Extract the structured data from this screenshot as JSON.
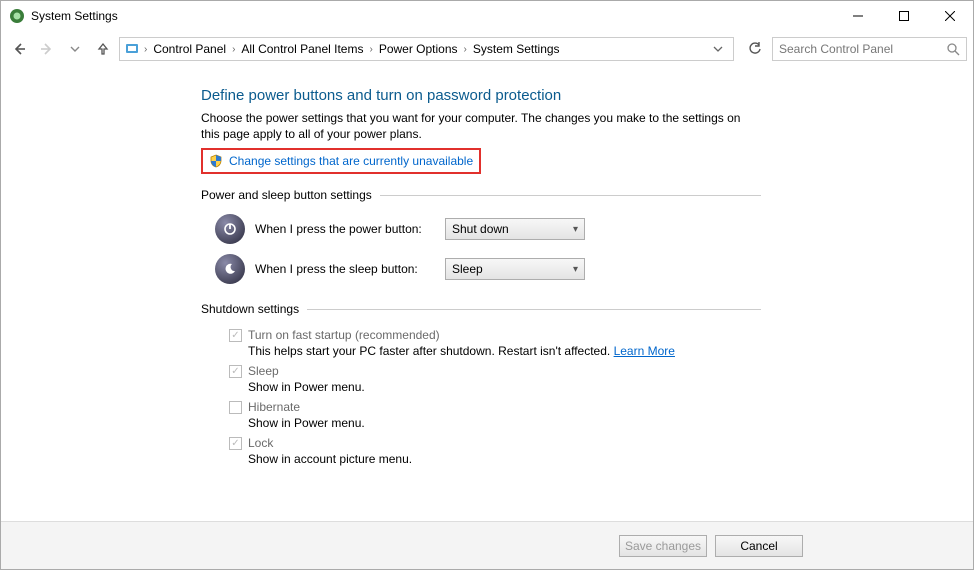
{
  "window": {
    "title": "System Settings"
  },
  "breadcrumb": {
    "items": [
      "Control Panel",
      "All Control Panel Items",
      "Power Options",
      "System Settings"
    ]
  },
  "search": {
    "placeholder": "Search Control Panel"
  },
  "page": {
    "heading": "Define power buttons and turn on password protection",
    "description": "Choose the power settings that you want for your computer. The changes you make to the settings on this page apply to all of your power plans.",
    "change_link": "Change settings that are currently unavailable"
  },
  "sections": {
    "power_sleep_title": "Power and sleep button settings",
    "power_button_label": "When I press the power button:",
    "power_button_value": "Shut down",
    "sleep_button_label": "When I press the sleep button:",
    "sleep_button_value": "Sleep",
    "shutdown_title": "Shutdown settings"
  },
  "shutdown": {
    "fast_startup": {
      "label": "Turn on fast startup (recommended)",
      "sub": "This helps start your PC faster after shutdown. Restart isn't affected.",
      "learn": "Learn More",
      "checked": true
    },
    "sleep": {
      "label": "Sleep",
      "sub": "Show in Power menu.",
      "checked": true
    },
    "hibernate": {
      "label": "Hibernate",
      "sub": "Show in Power menu.",
      "checked": false
    },
    "lock": {
      "label": "Lock",
      "sub": "Show in account picture menu.",
      "checked": true
    }
  },
  "footer": {
    "save": "Save changes",
    "cancel": "Cancel"
  }
}
